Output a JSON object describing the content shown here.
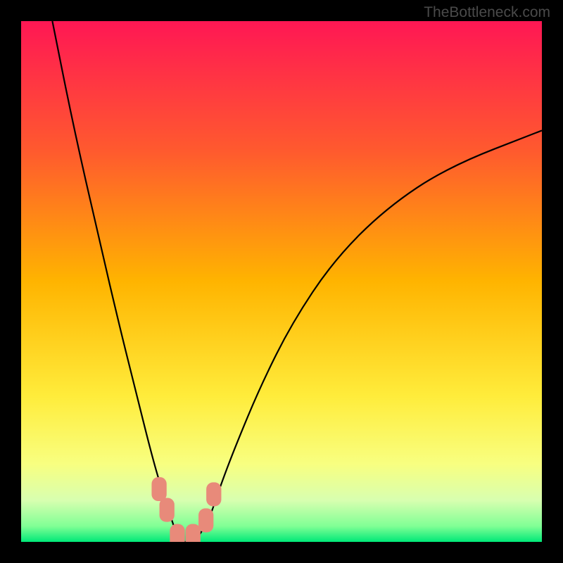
{
  "watermark": "TheBottleneck.com",
  "chart_data": {
    "type": "line",
    "title": "",
    "xlabel": "",
    "ylabel": "",
    "xlim": [
      0,
      100
    ],
    "ylim": [
      0,
      100
    ],
    "gradient": {
      "orientation": "vertical",
      "stops": [
        {
          "offset": 0,
          "color": "#ff1754"
        },
        {
          "offset": 0.25,
          "color": "#ff5a2e"
        },
        {
          "offset": 0.5,
          "color": "#ffb400"
        },
        {
          "offset": 0.72,
          "color": "#ffec3b"
        },
        {
          "offset": 0.85,
          "color": "#f8ff80"
        },
        {
          "offset": 0.92,
          "color": "#d8ffb0"
        },
        {
          "offset": 0.97,
          "color": "#80ff95"
        },
        {
          "offset": 1.0,
          "color": "#00e878"
        }
      ]
    },
    "series": [
      {
        "name": "bottleneck-curve",
        "color": "#000000",
        "x": [
          6,
          10,
          15,
          19,
          22,
          25,
          27,
          29,
          30,
          31,
          32,
          33,
          34,
          36,
          38,
          41,
          46,
          52,
          60,
          70,
          82,
          100
        ],
        "y": [
          100,
          80,
          58,
          41,
          29,
          17,
          10,
          4,
          1,
          0,
          0,
          0,
          1,
          4,
          10,
          18,
          30,
          42,
          54,
          64,
          72,
          79
        ]
      }
    ],
    "markers": [
      {
        "name": "marker-a",
        "x": 26.5,
        "y": 11,
        "color": "#e88a7a",
        "size": 10
      },
      {
        "name": "marker-b",
        "x": 28,
        "y": 7,
        "color": "#e88a7a",
        "size": 10
      },
      {
        "name": "marker-c",
        "x": 30,
        "y": 2,
        "color": "#e88a7a",
        "size": 10
      },
      {
        "name": "marker-d",
        "x": 33,
        "y": 2,
        "color": "#e88a7a",
        "size": 10
      },
      {
        "name": "marker-e",
        "x": 35.5,
        "y": 5,
        "color": "#e88a7a",
        "size": 10
      },
      {
        "name": "marker-f",
        "x": 37,
        "y": 10,
        "color": "#e88a7a",
        "size": 10
      }
    ]
  }
}
